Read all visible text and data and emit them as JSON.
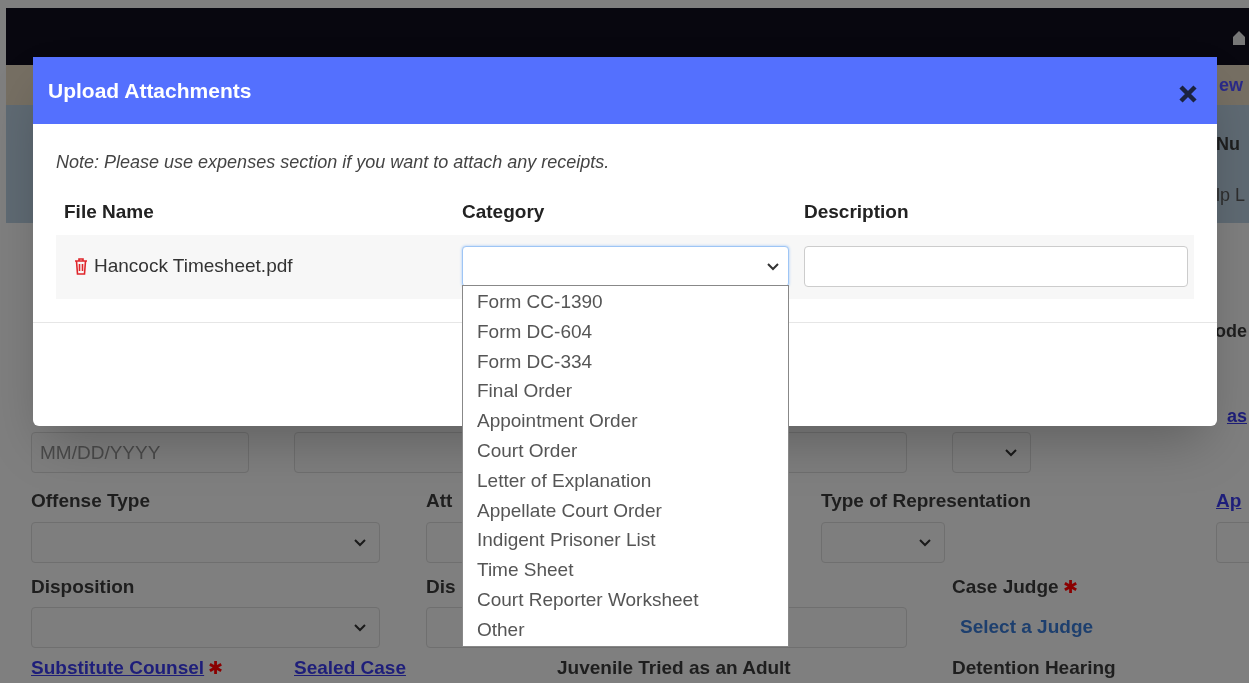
{
  "background": {
    "tab_fragment": "ew",
    "header_fragments": [
      "Nu",
      "lp L"
    ],
    "side_fragment": "ode",
    "link_fragment": "as",
    "date_placeholder": "MM/DD/YYYY",
    "row1": [
      {
        "label": "Offense Type",
        "kind": "text"
      },
      {
        "label": "Att",
        "kind": "text"
      },
      {
        "label": "Type of Representation",
        "kind": "text"
      },
      {
        "label": "Ap",
        "kind": "link"
      }
    ],
    "row2": [
      {
        "label": "Disposition",
        "kind": "text"
      },
      {
        "label": "Dis",
        "kind": "text"
      },
      {
        "label": "Case Judge",
        "kind": "text",
        "required_mark": "✱"
      }
    ],
    "judge_link": "Select a Judge",
    "row3": [
      {
        "label": "Substitute Counsel",
        "kind": "link",
        "required_mark": "✱"
      },
      {
        "label": "Sealed Case",
        "kind": "link"
      },
      {
        "label": "Juvenile Tried as an Adult",
        "kind": "text"
      },
      {
        "label": "Detention Hearing",
        "kind": "text"
      }
    ]
  },
  "modal": {
    "title": "Upload Attachments",
    "note": "Note: Please use expenses section if you want to attach any receipts.",
    "columns": [
      "File Name",
      "Category",
      "Description"
    ],
    "file": {
      "name": "Hancock Timesheet.pdf"
    },
    "category_options": [
      "Form CC-1390",
      "Form DC-604",
      "Form DC-334",
      "Final Order",
      "Appointment Order",
      "Court Order",
      "Letter of Explanation",
      "Appellate Court Order",
      "Indigent Prisoner List",
      "Time Sheet",
      "Court Reporter Worksheet",
      "Other"
    ]
  }
}
